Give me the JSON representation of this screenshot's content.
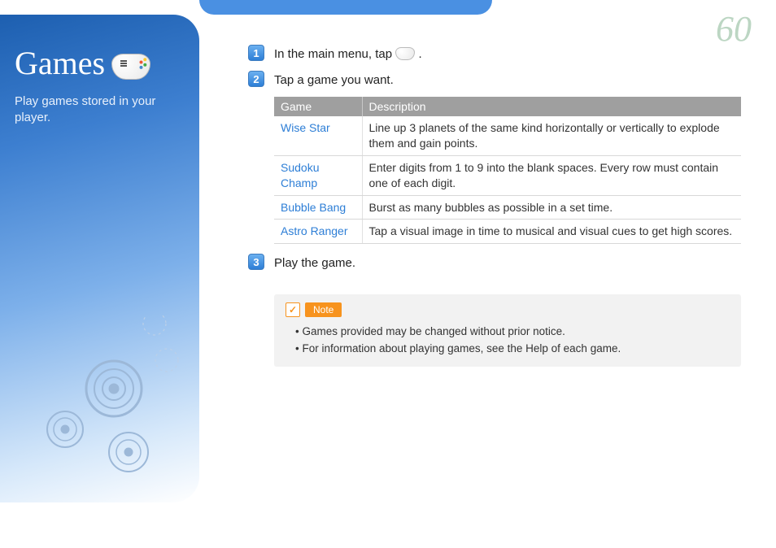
{
  "page_number": "60",
  "sidebar": {
    "title": "Games",
    "subtitle": "Play games stored in your player."
  },
  "steps": {
    "s1_pre": "In the main menu, tap ",
    "s1_post": ".",
    "s2": "Tap a game you want.",
    "s3": "Play the game."
  },
  "table": {
    "headers": {
      "game": "Game",
      "desc": "Description"
    },
    "rows": [
      {
        "game": "Wise Star",
        "desc": "Line up 3 planets of the same kind horizontally or vertically to explode them and gain points."
      },
      {
        "game": "Sudoku Champ",
        "desc": "Enter digits from 1 to 9 into the blank spaces. Every row must contain one of each digit."
      },
      {
        "game": "Bubble Bang",
        "desc": "Burst as many bubbles as possible in a set time."
      },
      {
        "game": "Astro Ranger",
        "desc": "Tap a visual image in time to musical and visual cues to get high scores."
      }
    ]
  },
  "note": {
    "label": "Note",
    "items": [
      "Games provided may be changed without prior notice.",
      "For information about playing games, see the Help of each game."
    ]
  }
}
